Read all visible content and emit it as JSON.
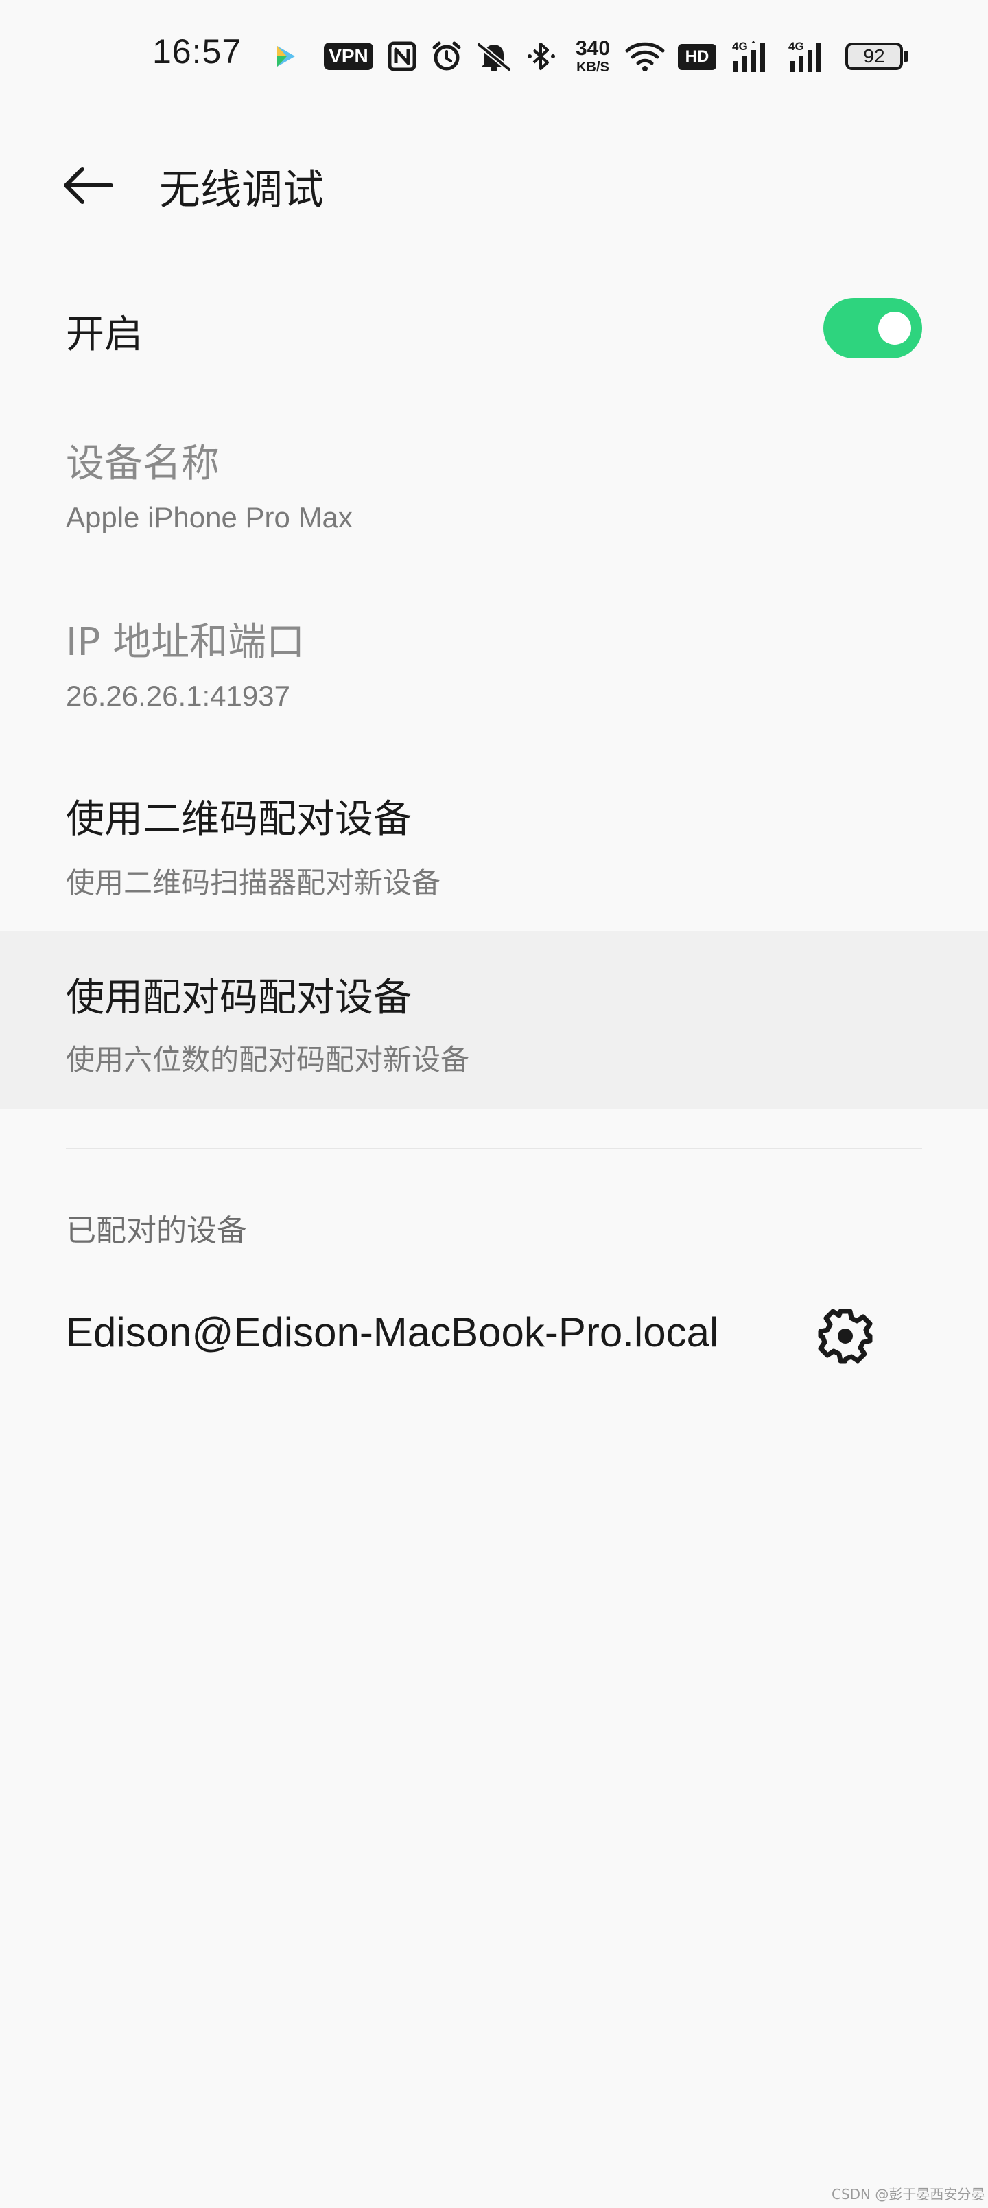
{
  "status_bar": {
    "time": "16:57",
    "vpn_label": "VPN",
    "speed_value": "340",
    "speed_unit": "KB/S",
    "hd_label": "HD",
    "battery_level": "92",
    "icons": [
      "video-app-icon",
      "vpn-icon",
      "nfc-icon",
      "alarm-icon",
      "mute-icon",
      "bluetooth-icon",
      "wifi-icon",
      "hd-voice-icon",
      "signal-4g-icon",
      "signal-4g-icon",
      "battery-icon"
    ]
  },
  "toolbar": {
    "back_icon": "arrow-back-icon",
    "title": "无线调试"
  },
  "settings": {
    "enable": {
      "title": "开启",
      "toggle_on": true,
      "toggle_color": "#2ed47e"
    },
    "device_name": {
      "title": "设备名称",
      "value": "Apple iPhone Pro Max"
    },
    "ip_port": {
      "title": "IP 地址和端口",
      "value": "26.26.26.1:41937"
    },
    "qr_pair": {
      "title": "使用二维码配对设备",
      "subtitle": "使用二维码扫描器配对新设备"
    },
    "code_pair": {
      "title": "使用配对码配对设备",
      "subtitle": "使用六位数的配对码配对新设备"
    }
  },
  "paired_section": {
    "header": "已配对的设备",
    "devices": [
      {
        "name": "Edison@Edison-MacBook-Pro.local",
        "action_icon": "gear-icon"
      }
    ]
  },
  "watermark": "CSDN @彭于晏西安分晏"
}
